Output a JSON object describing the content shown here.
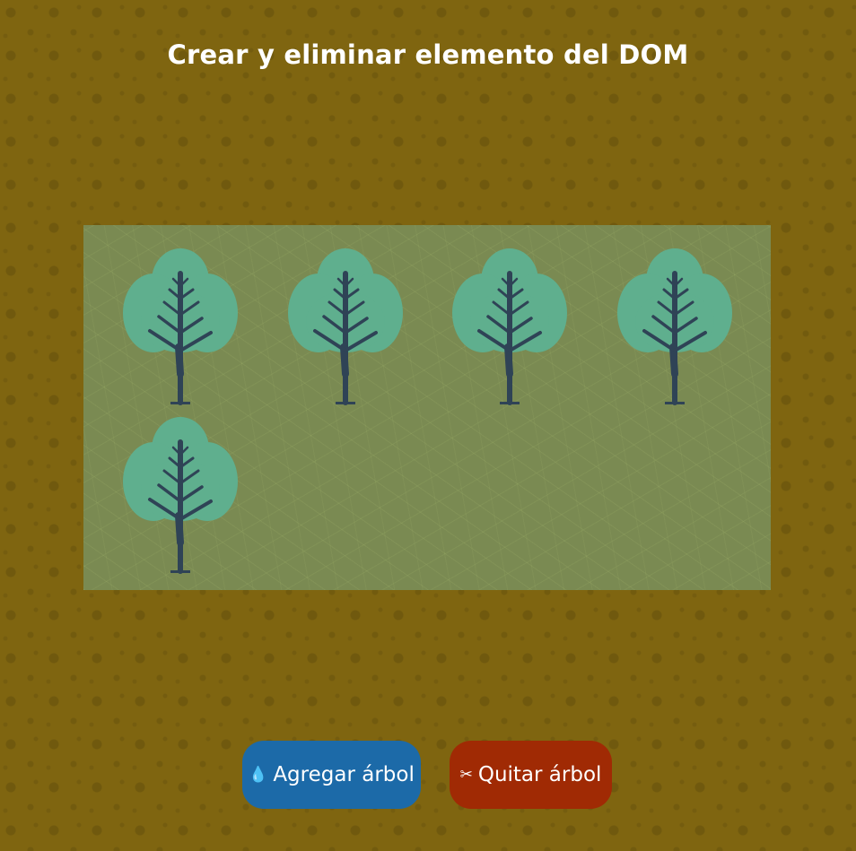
{
  "page": {
    "title": "Crear y eliminar elemento del DOM"
  },
  "garden": {
    "tree_count": 5,
    "tree_icon": "tree-icon",
    "colors": {
      "foliage": "#5faf8e",
      "trunk": "#2f4356",
      "grass": "#7a8a52",
      "soil": "#7f6510"
    }
  },
  "actions": {
    "add": {
      "icon": "💧",
      "icon_name": "water-drop-icon",
      "label": "Agregar árbol",
      "color": "#1c6aa8"
    },
    "remove": {
      "icon": "✂",
      "icon_name": "scissors-icon",
      "label": "Quitar árbol",
      "color": "#a02a04"
    }
  }
}
